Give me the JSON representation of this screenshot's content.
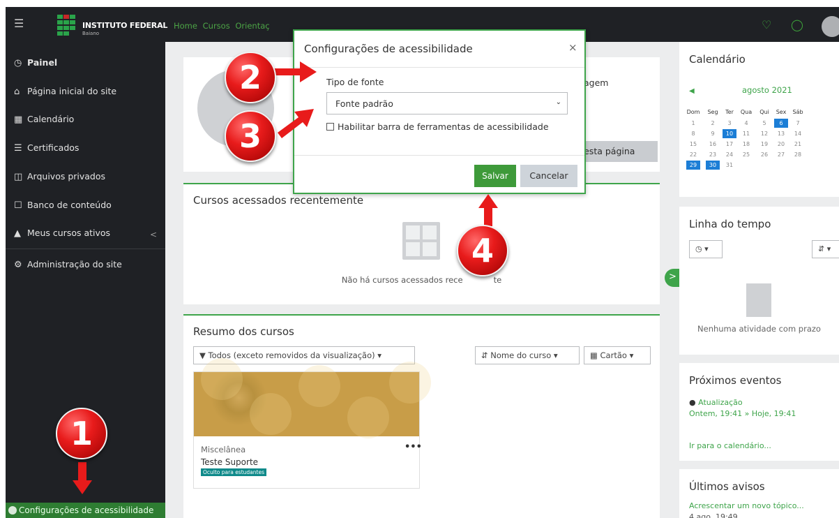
{
  "topbar": {
    "logo_text": "INSTITUTO FEDERAL",
    "logo_sub": "Baiano",
    "nav": [
      "Home",
      "Cursos",
      "Orientaç"
    ]
  },
  "sidebar": {
    "items": [
      {
        "label": "Painel",
        "icon": "dashboard-icon"
      },
      {
        "label": "Página inicial do site",
        "icon": "home-icon"
      },
      {
        "label": "Calendário",
        "icon": "calendar-icon"
      },
      {
        "label": "Certificados",
        "icon": "certificate-icon"
      },
      {
        "label": "Arquivos privados",
        "icon": "files-icon"
      },
      {
        "label": "Banco de conteúdo",
        "icon": "clipboard-icon"
      },
      {
        "label": "Meus cursos ativos",
        "icon": "graduation-cap-icon"
      },
      {
        "label": "Administração do site",
        "icon": "gear-icon"
      }
    ],
    "accessibility_label": "Configurações de acessibilidade"
  },
  "main": {
    "profile_message": "agem",
    "customize_label": "r esta página",
    "recent_title": "Cursos acessados recentemente",
    "recent_empty": "Não há cursos acessados rece",
    "recent_empty_tail": "te",
    "summary_title": "Resumo dos cursos",
    "filter_label": "Todos (exceto removidos da visualização)",
    "sort_label": "Nome do curso",
    "view_label": "Cartão",
    "course": {
      "category": "Miscelânea",
      "name": "Teste Suporte",
      "badge": "Oculto para estudantes",
      "more": "•••"
    }
  },
  "rightcol": {
    "calendar_title": "Calendário",
    "calendar_month": "agosto 2021",
    "weekdays": [
      "Dom",
      "Seg",
      "Ter",
      "Qua",
      "Qui",
      "Sex",
      "Sáb"
    ],
    "weeks": [
      [
        "1",
        "2",
        "3",
        "4",
        "5",
        "6",
        "7"
      ],
      [
        "8",
        "9",
        "10",
        "11",
        "12",
        "13",
        "14"
      ],
      [
        "15",
        "16",
        "17",
        "18",
        "19",
        "20",
        "21"
      ],
      [
        "22",
        "23",
        "24",
        "25",
        "26",
        "27",
        "28"
      ],
      [
        "29",
        "30",
        "31",
        "",
        "",
        "",
        ""
      ]
    ],
    "highlighted_days": [
      "6",
      "10",
      "29",
      "30"
    ],
    "timeline_title": "Linha do tempo",
    "timeline_empty": "Nenhuma atividade com prazo",
    "events_title": "Próximos eventos",
    "event_name": "Atualização",
    "event_time_start": "Ontem, 19:41",
    "event_time_end": "Hoje, 19:41",
    "calendar_link": "Ir para o calendário...",
    "news_title": "Últimos avisos",
    "news_link": "Acrescentar um novo tópico...",
    "news_date": "4 ago, 19:49"
  },
  "modal": {
    "title": "Configurações de acessibilidade",
    "close": "×",
    "font_label": "Tipo de fonte",
    "font_value": "Fonte padrão",
    "toolbar_label": "Habilitar barra de ferramentas de acessibilidade",
    "toolbar_checked": false,
    "save_label": "Salvar",
    "cancel_label": "Cancelar"
  },
  "markers": [
    "1",
    "2",
    "3",
    "4"
  ],
  "colors": {
    "accent": "#3ea44a",
    "dark": "#1f2125",
    "marker": "#e81b1b",
    "calendar_highlight": "#1c7ed6"
  }
}
